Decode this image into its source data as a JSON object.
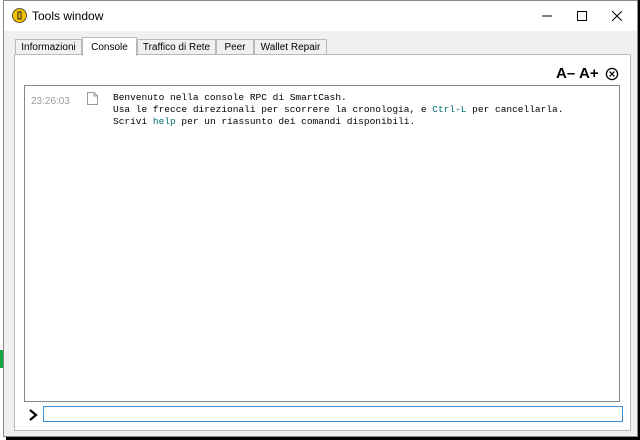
{
  "window": {
    "title": "Tools window",
    "minimize_icon": "minimize-icon",
    "maximize_icon": "maximize-icon",
    "close_icon": "close-icon"
  },
  "tabs": [
    {
      "label": "Informazioni",
      "active": false
    },
    {
      "label": "Console",
      "active": true
    },
    {
      "label": "Traffico di Rete",
      "active": false
    },
    {
      "label": "Peer",
      "active": false
    },
    {
      "label": "Wallet Repair",
      "active": false
    }
  ],
  "toolbar": {
    "font_smaller_label": "A–",
    "font_larger_label": "A+",
    "clear_icon": "clear-console-icon"
  },
  "console": {
    "timestamp": "23:26:03",
    "line1": "Benvenuto nella console RPC di SmartCash.",
    "line2_pre": "Usa le frecce direzionali per scorrere la cronologia, e ",
    "line2_cmd": "Ctrl-L",
    "line2_post": " per cancellarla.",
    "line3_pre": "Scrivi ",
    "line3_cmd": "help",
    "line3_post": " per un riassunto dei comandi disponibili.",
    "command_color": "#006a70"
  },
  "input": {
    "value": "",
    "placeholder": ""
  },
  "colors": {
    "input_border": "#3c8fd6",
    "desktop_accent": "#14a83c"
  }
}
